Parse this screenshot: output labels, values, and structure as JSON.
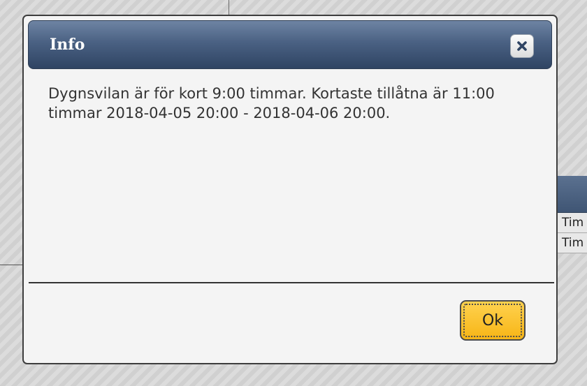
{
  "dialog": {
    "title": "Info",
    "message": "Dygnsvilan är för kort 9:00 timmar. Kortaste tillåtna är 11:00 timmar 2018-04-05 20:00 - 2018-04-06 20:00.",
    "ok_label": "Ok",
    "close_icon": "close-icon"
  },
  "background": {
    "table_rows": [
      "Tim",
      "Tim"
    ]
  },
  "colors": {
    "header": "#4a6183",
    "ok_button": "#f9bf22"
  }
}
